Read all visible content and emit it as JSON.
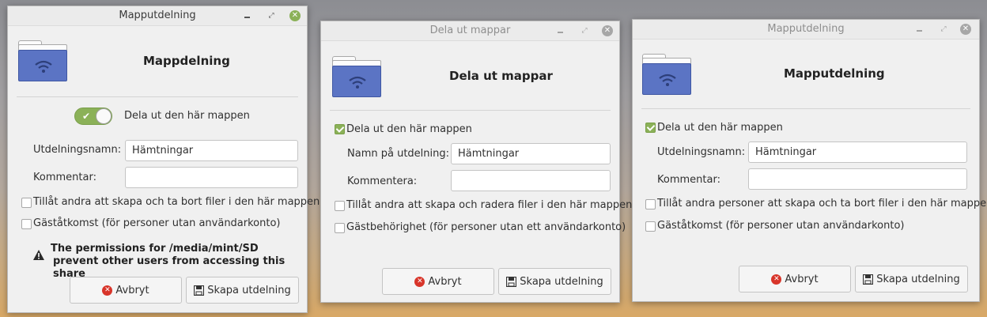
{
  "windows": [
    {
      "title": "Mapputdelning",
      "heading": "Mappdelning",
      "share_label": "Dela ut den här mappen",
      "share_checked": true,
      "name_label": "Utdelningsnamn:",
      "name_value": "Hämtningar",
      "comment_label": "Kommentar:",
      "comment_value": "",
      "allow_label": "Tillåt andra att skapa och ta bort filer i den här mappen",
      "guest_label": "Gäståtkomst (för personer utan användarkonto)",
      "warning_line1": "The permissions for /media/mint/SD",
      "warning_line2": "prevent other users from accessing this share",
      "cancel_label": "Avbryt",
      "create_label": "Skapa utdelning",
      "active": true
    },
    {
      "title": "Dela ut mappar",
      "heading": "Dela ut mappar",
      "share_label": "Dela ut den här mappen",
      "share_checked": true,
      "name_label": "Namn på utdelning:",
      "name_value": "Hämtningar",
      "comment_label": "Kommentera:",
      "comment_value": "",
      "allow_label": "Tillåt andra att skapa och radera filer i den här mappen",
      "guest_label": "Gästbehörighet (för personer utan ett användarkonto)",
      "cancel_label": "Avbryt",
      "create_label": "Skapa utdelning",
      "active": false
    },
    {
      "title": "Mapputdelning",
      "heading": "Mapputdelning",
      "share_label": "Dela ut den här mappen",
      "share_checked": true,
      "name_label": "Utdelningsnamn:",
      "name_value": "Hämtningar",
      "comment_label": "Kommentar:",
      "comment_value": "",
      "allow_label": "Tillåt andra personer att skapa och ta bort filer i den här mappen",
      "guest_label": "Gäståtkomst (för personer utan användarkonto)",
      "cancel_label": "Avbryt",
      "create_label": "Skapa utdelning",
      "active": false
    }
  ],
  "icons": {
    "folder": "folder-network-icon",
    "minimize": "minimize-icon",
    "maximize": "maximize-icon",
    "close": "close-icon",
    "cancel": "cancel-icon",
    "save": "save-icon",
    "warning": "warning-icon"
  },
  "colors": {
    "accent": "#8bb158",
    "folder": "#5b74c4",
    "cancel": "#d8352a"
  }
}
